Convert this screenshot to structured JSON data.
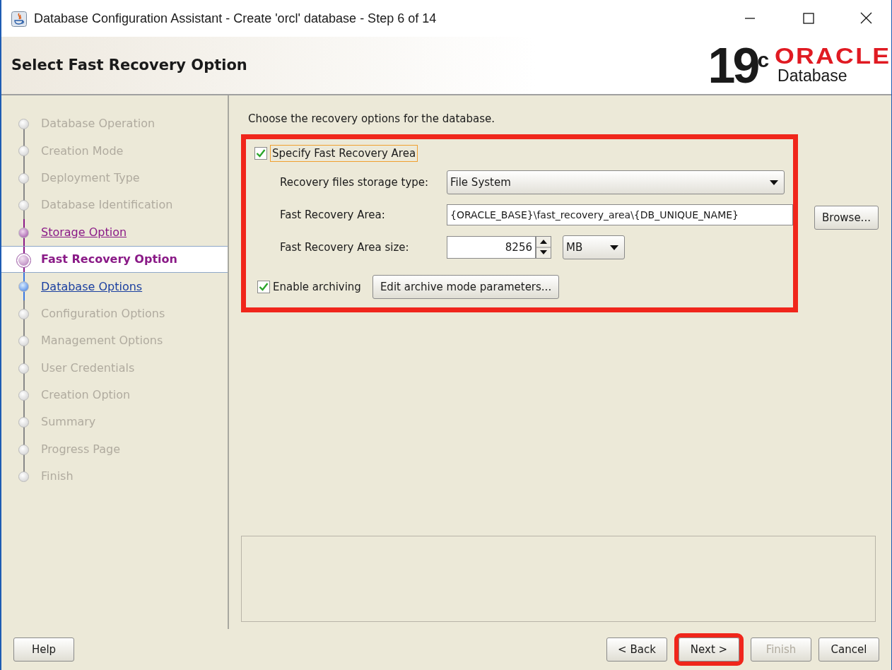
{
  "window": {
    "title": "Database Configuration Assistant - Create 'orcl' database - Step 6 of 14"
  },
  "header": {
    "title": "Select Fast Recovery Option",
    "logo": {
      "version": "19",
      "suffix": "c",
      "brand": "ORACLE",
      "product": "Database"
    }
  },
  "steps": [
    {
      "label": "Database Operation",
      "kind": "disabled",
      "selected": false
    },
    {
      "label": "Creation Mode",
      "kind": "disabled",
      "selected": false
    },
    {
      "label": "Deployment Type",
      "kind": "disabled",
      "selected": false
    },
    {
      "label": "Database Identification",
      "kind": "disabled",
      "selected": false
    },
    {
      "label": "Storage Option",
      "kind": "visited",
      "selected": false
    },
    {
      "label": "Fast Recovery Option",
      "kind": "current",
      "selected": true
    },
    {
      "label": "Database Options",
      "kind": "next",
      "selected": false
    },
    {
      "label": "Configuration Options",
      "kind": "disabled",
      "selected": false
    },
    {
      "label": "Management Options",
      "kind": "disabled",
      "selected": false
    },
    {
      "label": "User Credentials",
      "kind": "disabled",
      "selected": false
    },
    {
      "label": "Creation Option",
      "kind": "disabled",
      "selected": false
    },
    {
      "label": "Summary",
      "kind": "disabled",
      "selected": false
    },
    {
      "label": "Progress Page",
      "kind": "disabled",
      "selected": false
    },
    {
      "label": "Finish",
      "kind": "disabled",
      "selected": false
    }
  ],
  "content": {
    "intro": "Choose the recovery options for the database.",
    "highlighted": true,
    "specify_fra": {
      "label": "Specify Fast Recovery Area",
      "checked": true
    },
    "storage_type": {
      "label": "Recovery files storage type:",
      "value": "File System"
    },
    "fra_location": {
      "label": "Fast Recovery Area:",
      "value": "{ORACLE_BASE}\\fast_recovery_area\\{DB_UNIQUE_NAME}",
      "button": "Browse..."
    },
    "fra_size": {
      "label": "Fast Recovery Area size:",
      "value": "8256",
      "unit": "MB"
    },
    "archiving": {
      "label": "Enable archiving",
      "checked": true,
      "button": "Edit archive mode parameters..."
    }
  },
  "buttons": [
    {
      "label": "Help",
      "disabled": false,
      "highlighted": false
    },
    {
      "label": "< Back",
      "disabled": false,
      "highlighted": false
    },
    {
      "label": "Next >",
      "disabled": false,
      "highlighted": true
    },
    {
      "label": "Finish",
      "disabled": true,
      "highlighted": false
    },
    {
      "label": "Cancel",
      "disabled": false,
      "highlighted": false
    }
  ]
}
